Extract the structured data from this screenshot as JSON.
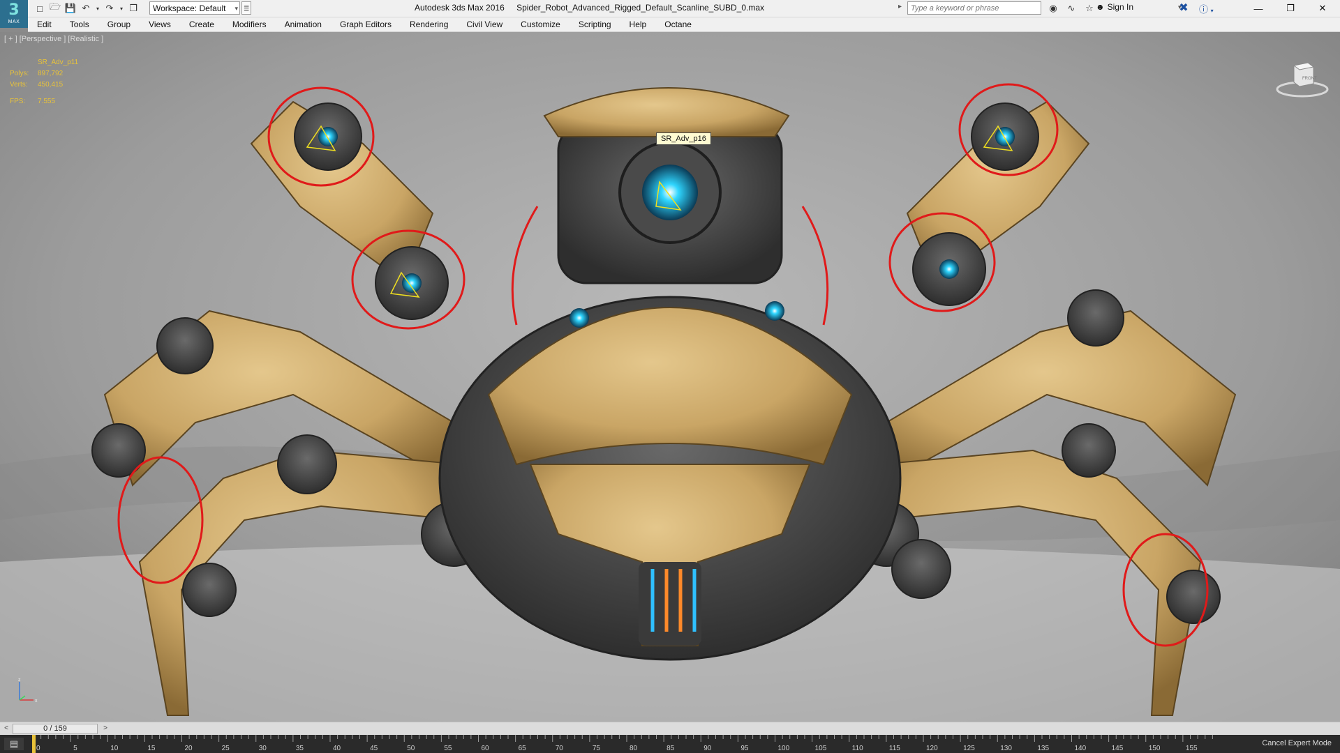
{
  "app": {
    "logo_text": "MAX",
    "title": "Autodesk 3ds Max 2016",
    "file": "Spider_Robot_Advanced_Rigged_Default_Scanline_SUBD_0.max"
  },
  "toolbar": {
    "workspace": "Workspace: Default",
    "search_placeholder": "Type a keyword or phrase",
    "sign_in": "Sign In"
  },
  "menu": [
    "Edit",
    "Tools",
    "Group",
    "Views",
    "Create",
    "Modifiers",
    "Animation",
    "Graph Editors",
    "Rendering",
    "Civil View",
    "Customize",
    "Scripting",
    "Help",
    "Octane"
  ],
  "viewport": {
    "label": "[ + ] [Perspective ] [Realistic ]",
    "object_name": "SR_Adv_p11",
    "stats": [
      {
        "label": "Polys:",
        "value": "897,792"
      },
      {
        "label": "Verts:",
        "value": "450,415"
      }
    ],
    "fps_label": "FPS:",
    "fps_value": "7.555",
    "tooltip": "SR_Adv_p16",
    "viewcube_label": "FRONT"
  },
  "timeline": {
    "slider_label": "0 / 159",
    "ticks": [
      "0",
      "5",
      "10",
      "15",
      "20",
      "25",
      "30",
      "35",
      "40",
      "45",
      "50",
      "55",
      "60",
      "65",
      "70",
      "75",
      "80",
      "85",
      "90",
      "95",
      "100",
      "105",
      "110",
      "115",
      "120",
      "125",
      "130",
      "135",
      "140",
      "145",
      "150",
      "155"
    ],
    "cancel_label": "Cancel Expert Mode"
  }
}
